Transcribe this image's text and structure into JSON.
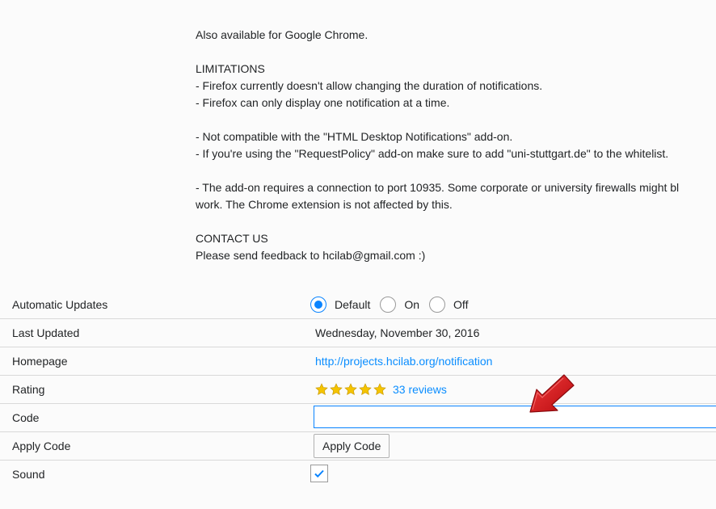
{
  "description": {
    "lines": [
      "Also available for Google Chrome.",
      "",
      "LIMITATIONS",
      "- Firefox currently doesn't allow changing the duration of notifications.",
      "- Firefox can only display one notification at a time.",
      "",
      "- Not compatible with the \"HTML Desktop Notifications\" add-on.",
      "- If you're using the \"RequestPolicy\" add-on make sure to add \"uni-stuttgart.de\" to the whitelist.",
      "",
      "- The add-on requires a connection to port 10935. Some corporate or university firewalls might bl",
      "work. The Chrome extension is not affected by this.",
      "",
      "CONTACT US",
      "Please send feedback to hcilab@gmail.com :)"
    ]
  },
  "details": {
    "automatic_updates": {
      "label": "Automatic Updates",
      "options": [
        "Default",
        "On",
        "Off"
      ],
      "selected": "Default"
    },
    "last_updated": {
      "label": "Last Updated",
      "value": "Wednesday, November 30, 2016"
    },
    "homepage": {
      "label": "Homepage",
      "value": "http://projects.hcilab.org/notification"
    },
    "rating": {
      "label": "Rating",
      "stars": 5,
      "reviews_text": "33 reviews"
    },
    "code": {
      "label": "Code",
      "value": ""
    },
    "apply_code": {
      "label": "Apply Code",
      "button_label": "Apply Code"
    },
    "sound": {
      "label": "Sound",
      "checked": true
    }
  },
  "colors": {
    "accent": "#0a84ff",
    "link": "#0a8dff",
    "star": "#f5c400",
    "arrow": "#d8141a"
  }
}
